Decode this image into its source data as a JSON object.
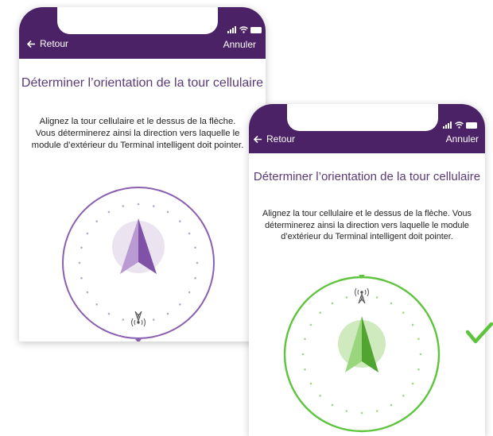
{
  "screens": [
    {
      "state": "not-aligned",
      "back_label": "Retour",
      "cancel_label": "Annuler",
      "title": "Déterminer l’orientation de la tour cellulaire",
      "description": "Alignez la tour cellulaire et le dessus de la flèche. Vous déterminerez ainsi la direction vers laquelle le module d’extérieur du Terminal intelligent doit pointer.",
      "ring_color": "#8a5fb0",
      "arrow_color": "#8a5fb0",
      "tower_position": "bottom"
    },
    {
      "state": "aligned",
      "back_label": "Retour",
      "cancel_label": "Annuler",
      "title": "Déterminer l’orientation de la tour cellulaire",
      "description": "Alignez la tour cellulaire et le dessus de la flèche. Vous déterminerez ainsi la direction vers laquelle le module d’extérieur du Terminal intelligent doit pointer.",
      "ring_color": "#5ec43d",
      "arrow_color": "#6cc24a",
      "tower_position": "top"
    }
  ],
  "header_color": "#4b2266",
  "success_icon": "checkmark-icon",
  "success_color": "#5ec43d"
}
